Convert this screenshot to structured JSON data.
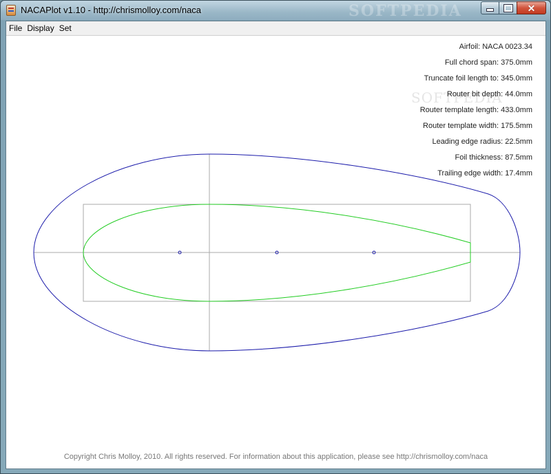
{
  "window": {
    "title": "NACAPlot v1.10 - http://chrismolloy.com/naca",
    "watermark": "SOFTPEDIA",
    "caption_buttons": {
      "minimize": "minimize",
      "maximize": "maximize",
      "close": "✕"
    }
  },
  "menu": {
    "items": [
      {
        "label": "File"
      },
      {
        "label": "Display"
      },
      {
        "label": "Set"
      }
    ]
  },
  "info": {
    "lines": [
      "Airfoil: NACA 0023.34",
      "Full chord span: 375.0mm",
      "Truncate foil length to: 345.0mm",
      "Router bit depth: 44.0mm",
      "Router template length: 433.0mm",
      "Router template width: 175.5mm",
      "Leading edge radius: 22.5mm",
      "Foil thickness: 87.5mm",
      "Trailing edge width: 17.4mm"
    ]
  },
  "canvas_watermark": "SOFTPEDIA",
  "footer": "Copyright Chris Molloy, 2010. All rights reserved. For information about this application, please see http://chrismolloy.com/naca",
  "colors": {
    "template_outline": "#1a1aaa",
    "foil_profile": "#22cc22",
    "guides": "#aaaaaa",
    "markers": "#1a1aaa"
  }
}
